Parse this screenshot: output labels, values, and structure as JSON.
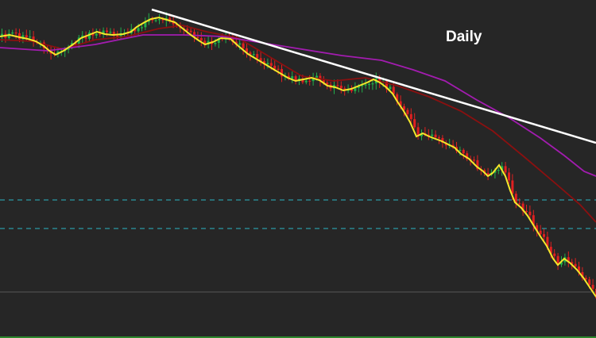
{
  "chart_label": "Daily",
  "colors": {
    "background": "#262626",
    "bull_candle": "#22b04a",
    "bear_candle": "#e02020",
    "ema_fast": "#f5e82a",
    "ma_mid": "#a21caf",
    "ma_slow": "#8b1010",
    "trendline": "#ffffff",
    "level_lines": "#2ab7c4",
    "flat_line": "#555555",
    "bottom_rule": "#2ea82e"
  },
  "chart_data": {
    "type": "candlestick",
    "title": "Daily",
    "xlabel": "",
    "ylabel": "",
    "grid": false,
    "ylim": [
      0,
      426
    ],
    "close_series": [
      [
        0,
        46
      ],
      [
        12,
        44
      ],
      [
        25,
        47
      ],
      [
        35,
        49
      ],
      [
        45,
        52
      ],
      [
        55,
        58
      ],
      [
        62,
        64
      ],
      [
        70,
        69
      ],
      [
        80,
        64
      ],
      [
        92,
        56
      ],
      [
        102,
        48
      ],
      [
        112,
        44
      ],
      [
        122,
        40
      ],
      [
        132,
        43
      ],
      [
        142,
        44
      ],
      [
        155,
        43
      ],
      [
        165,
        40
      ],
      [
        172,
        34
      ],
      [
        182,
        28
      ],
      [
        190,
        24
      ],
      [
        200,
        22
      ],
      [
        210,
        25
      ],
      [
        220,
        28
      ],
      [
        230,
        36
      ],
      [
        240,
        44
      ],
      [
        250,
        51
      ],
      [
        258,
        56
      ],
      [
        268,
        53
      ],
      [
        278,
        48
      ],
      [
        290,
        49
      ],
      [
        300,
        58
      ],
      [
        312,
        68
      ],
      [
        322,
        74
      ],
      [
        332,
        80
      ],
      [
        342,
        86
      ],
      [
        352,
        92
      ],
      [
        362,
        98
      ],
      [
        372,
        102
      ],
      [
        382,
        100
      ],
      [
        392,
        98
      ],
      [
        402,
        101
      ],
      [
        412,
        108
      ],
      [
        422,
        110
      ],
      [
        432,
        114
      ],
      [
        442,
        112
      ],
      [
        452,
        108
      ],
      [
        462,
        104
      ],
      [
        470,
        100
      ],
      [
        478,
        104
      ],
      [
        486,
        110
      ],
      [
        494,
        118
      ],
      [
        500,
        128
      ],
      [
        508,
        140
      ],
      [
        516,
        154
      ],
      [
        524,
        172
      ],
      [
        532,
        168
      ],
      [
        540,
        172
      ],
      [
        548,
        175
      ],
      [
        556,
        178
      ],
      [
        564,
        182
      ],
      [
        572,
        186
      ],
      [
        580,
        194
      ],
      [
        590,
        200
      ],
      [
        600,
        210
      ],
      [
        608,
        216
      ],
      [
        614,
        222
      ],
      [
        620,
        218
      ],
      [
        628,
        208
      ],
      [
        636,
        222
      ],
      [
        642,
        240
      ],
      [
        648,
        255
      ],
      [
        656,
        262
      ],
      [
        664,
        272
      ],
      [
        672,
        285
      ],
      [
        680,
        298
      ],
      [
        688,
        310
      ],
      [
        696,
        326
      ],
      [
        702,
        334
      ],
      [
        710,
        326
      ],
      [
        718,
        332
      ],
      [
        726,
        340
      ],
      [
        734,
        350
      ],
      [
        742,
        362
      ],
      [
        750,
        374
      ]
    ],
    "series": [
      {
        "values": [
          [
            0,
            50
          ],
          [
            40,
            52
          ],
          [
            80,
            62
          ],
          [
            120,
            50
          ],
          [
            160,
            46
          ],
          [
            200,
            36
          ],
          [
            230,
            32
          ],
          [
            260,
            40
          ],
          [
            300,
            48
          ],
          [
            340,
            72
          ],
          [
            380,
            96
          ],
          [
            420,
            102
          ],
          [
            460,
            98
          ],
          [
            500,
            108
          ],
          [
            540,
            122
          ],
          [
            580,
            140
          ],
          [
            620,
            165
          ],
          [
            660,
            198
          ],
          [
            700,
            232
          ],
          [
            730,
            258
          ],
          [
            750,
            280
          ]
        ]
      },
      {
        "values": [
          [
            0,
            60
          ],
          [
            60,
            64
          ],
          [
            120,
            56
          ],
          [
            180,
            44
          ],
          [
            230,
            44
          ],
          [
            280,
            46
          ],
          [
            330,
            54
          ],
          [
            380,
            62
          ],
          [
            430,
            70
          ],
          [
            480,
            76
          ],
          [
            520,
            88
          ],
          [
            560,
            102
          ],
          [
            600,
            126
          ],
          [
            640,
            148
          ],
          [
            680,
            174
          ],
          [
            710,
            196
          ],
          [
            735,
            216
          ],
          [
            750,
            222
          ]
        ]
      }
    ],
    "annotations": [
      {
        "type": "trendline",
        "from": [
          191,
          12
        ],
        "to": [
          750,
          180
        ]
      },
      {
        "type": "horizontal_level",
        "y": 252
      },
      {
        "type": "horizontal_level",
        "y": 288
      },
      {
        "type": "horizontal_level",
        "y": 368
      }
    ]
  }
}
